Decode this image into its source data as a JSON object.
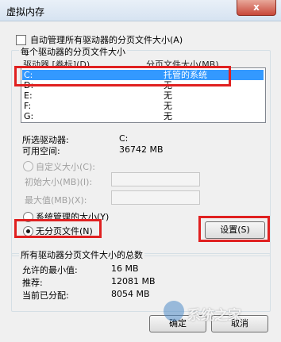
{
  "window": {
    "title": "虚拟内存",
    "close_glyph": "x"
  },
  "auto_manage": {
    "label": "自动管理所有驱动器的分页文件大小(A)",
    "checked": false
  },
  "drives_group": {
    "title": "每个驱动器的分页文件大小",
    "col_drive": "驱动器 [卷标](D)",
    "col_pagefile": "分页文件大小(MB)",
    "rows": [
      {
        "drive": "C:",
        "size": "托管的系统"
      },
      {
        "drive": "D:",
        "size": "无"
      },
      {
        "drive": "E:",
        "size": "无"
      },
      {
        "drive": "F:",
        "size": "无"
      },
      {
        "drive": "G:",
        "size": "无"
      }
    ],
    "selected_drive_label": "所选驱动器:",
    "selected_drive_value": "C:",
    "free_space_label": "可用空间:",
    "free_space_value": "36742 MB",
    "custom_size_label": "自定义大小(C):",
    "initial_size_label": "初始大小(MB)(I):",
    "max_size_label": "最大值(MB)(X):",
    "system_managed_label": "系统管理的大小(Y)",
    "no_paging_label": "无分页文件(N)",
    "set_button": "设置(S)"
  },
  "totals_group": {
    "title": "所有驱动器分页文件大小的总数",
    "min_label": "允许的最小值:",
    "min_value": "16 MB",
    "recommended_label": "推荐:",
    "recommended_value": "12081 MB",
    "current_label": "当前已分配:",
    "current_value": "8054 MB"
  },
  "buttons": {
    "ok": "确定",
    "cancel": "取消"
  },
  "watermark": "系统之家",
  "colors": {
    "highlight": "#e02020",
    "selection": "#3399ff"
  }
}
